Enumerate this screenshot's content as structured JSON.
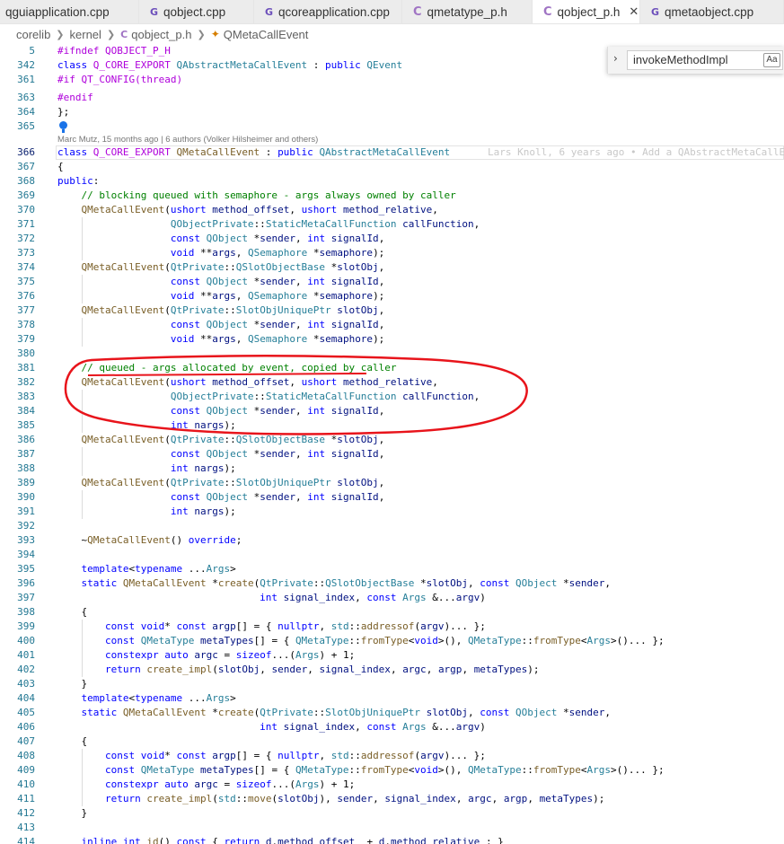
{
  "tabs": [
    {
      "icon": "",
      "label": "qguiapplication.cpp",
      "active": false
    },
    {
      "icon": "G",
      "label": "qobject.cpp",
      "active": false
    },
    {
      "icon": "G",
      "label": "qcoreapplication.cpp",
      "active": false
    },
    {
      "icon": "C",
      "label": "qmetatype_p.h",
      "active": false
    },
    {
      "icon": "C",
      "label": "qobject_p.h",
      "active": true
    },
    {
      "icon": "G",
      "label": "qmetaobject.cpp",
      "active": false
    }
  ],
  "breadcrumb": {
    "parts": [
      "corelib",
      "kernel"
    ],
    "file": "qobject_p.h",
    "symbol": "QMetaCallEvent"
  },
  "find": {
    "value": "invokeMethodImpl",
    "match_case_label": "Aa"
  },
  "codelens": "Marc Mutz, 15 months ago | 6 authors (Volker Hilsheimer and others)",
  "blame": "Lars Knoll, 6 years ago • Add a QAbstractMetaCallE",
  "lines": [
    {
      "n": "5",
      "t": "#ifndef QOBJECT_P_H"
    },
    {
      "n": "342",
      "t": "class Q_CORE_EXPORT QAbstractMetaCallEvent : public QEvent"
    },
    {
      "n": "361",
      "t": "#if QT_CONFIG(thread)"
    },
    {
      "n": "363",
      "t": "#endif"
    },
    {
      "n": "364",
      "t": "};"
    },
    {
      "n": "365",
      "t": ""
    },
    {
      "n": "366",
      "t": "class Q_CORE_EXPORT QMetaCallEvent : public QAbstractMetaCallEvent"
    },
    {
      "n": "367",
      "t": "{"
    },
    {
      "n": "368",
      "t": "public:"
    },
    {
      "n": "369",
      "t": "    // blocking queued with semaphore - args always owned by caller"
    },
    {
      "n": "370",
      "t": "    QMetaCallEvent(ushort method_offset, ushort method_relative,"
    },
    {
      "n": "371",
      "t": "                   QObjectPrivate::StaticMetaCallFunction callFunction,"
    },
    {
      "n": "372",
      "t": "                   const QObject *sender, int signalId,"
    },
    {
      "n": "373",
      "t": "                   void **args, QSemaphore *semaphore);"
    },
    {
      "n": "374",
      "t": "    QMetaCallEvent(QtPrivate::QSlotObjectBase *slotObj,"
    },
    {
      "n": "375",
      "t": "                   const QObject *sender, int signalId,"
    },
    {
      "n": "376",
      "t": "                   void **args, QSemaphore *semaphore);"
    },
    {
      "n": "377",
      "t": "    QMetaCallEvent(QtPrivate::SlotObjUniquePtr slotObj,"
    },
    {
      "n": "378",
      "t": "                   const QObject *sender, int signalId,"
    },
    {
      "n": "379",
      "t": "                   void **args, QSemaphore *semaphore);"
    },
    {
      "n": "380",
      "t": ""
    },
    {
      "n": "381",
      "t": "    // queued - args allocated by event, copied by caller"
    },
    {
      "n": "382",
      "t": "    QMetaCallEvent(ushort method_offset, ushort method_relative,"
    },
    {
      "n": "383",
      "t": "                   QObjectPrivate::StaticMetaCallFunction callFunction,"
    },
    {
      "n": "384",
      "t": "                   const QObject *sender, int signalId,"
    },
    {
      "n": "385",
      "t": "                   int nargs);"
    },
    {
      "n": "386",
      "t": "    QMetaCallEvent(QtPrivate::QSlotObjectBase *slotObj,"
    },
    {
      "n": "387",
      "t": "                   const QObject *sender, int signalId,"
    },
    {
      "n": "388",
      "t": "                   int nargs);"
    },
    {
      "n": "389",
      "t": "    QMetaCallEvent(QtPrivate::SlotObjUniquePtr slotObj,"
    },
    {
      "n": "390",
      "t": "                   const QObject *sender, int signalId,"
    },
    {
      "n": "391",
      "t": "                   int nargs);"
    },
    {
      "n": "392",
      "t": ""
    },
    {
      "n": "393",
      "t": "    ~QMetaCallEvent() override;"
    },
    {
      "n": "394",
      "t": ""
    },
    {
      "n": "395",
      "t": "    template<typename ...Args>"
    },
    {
      "n": "396",
      "t": "    static QMetaCallEvent *create(QtPrivate::QSlotObjectBase *slotObj, const QObject *sender,"
    },
    {
      "n": "397",
      "t": "                                  int signal_index, const Args &...argv)"
    },
    {
      "n": "398",
      "t": "    {"
    },
    {
      "n": "399",
      "t": "        const void* const argp[] = { nullptr, std::addressof(argv)... };"
    },
    {
      "n": "400",
      "t": "        const QMetaType metaTypes[] = { QMetaType::fromType<void>(), QMetaType::fromType<Args>()... };"
    },
    {
      "n": "401",
      "t": "        constexpr auto argc = sizeof...(Args) + 1;"
    },
    {
      "n": "402",
      "t": "        return create_impl(slotObj, sender, signal_index, argc, argp, metaTypes);"
    },
    {
      "n": "403",
      "t": "    }"
    },
    {
      "n": "404",
      "t": "    template<typename ...Args>"
    },
    {
      "n": "405",
      "t": "    static QMetaCallEvent *create(QtPrivate::SlotObjUniquePtr slotObj, const QObject *sender,"
    },
    {
      "n": "406",
      "t": "                                  int signal_index, const Args &...argv)"
    },
    {
      "n": "407",
      "t": "    {"
    },
    {
      "n": "408",
      "t": "        const void* const argp[] = { nullptr, std::addressof(argv)... };"
    },
    {
      "n": "409",
      "t": "        const QMetaType metaTypes[] = { QMetaType::fromType<void>(), QMetaType::fromType<Args>()... };"
    },
    {
      "n": "410",
      "t": "        constexpr auto argc = sizeof...(Args) + 1;"
    },
    {
      "n": "411",
      "t": "        return create_impl(std::move(slotObj), sender, signal_index, argc, argp, metaTypes);"
    },
    {
      "n": "412",
      "t": "    }"
    },
    {
      "n": "413",
      "t": ""
    },
    {
      "n": "414",
      "t": "    inline int id() const { return d.method_offset_ + d.method_relative_; }"
    }
  ],
  "colors": {
    "keyword": "#0000ff",
    "preprocessor": "#af00db",
    "type": "#267f99",
    "comment": "#008000",
    "function": "#795e26",
    "param": "#001080",
    "line_number": "#237893",
    "annotation": "#e8141b"
  }
}
